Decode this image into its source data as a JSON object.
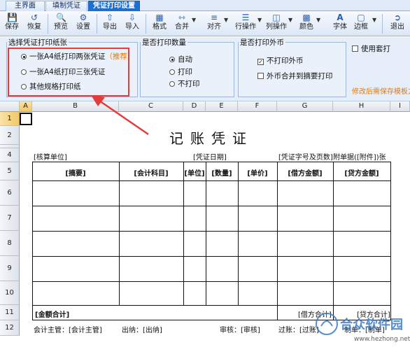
{
  "tabs": [
    {
      "label": "主界面",
      "active": false
    },
    {
      "label": "填制凭证",
      "active": false
    },
    {
      "label": "凭证打印设置",
      "active": true
    }
  ],
  "toolbar": {
    "save": "保存",
    "restore": "恢复",
    "preview": "预览",
    "settings": "设置",
    "export": "导出",
    "import": "导入",
    "format": "格式",
    "merge": "合并",
    "align": "对齐",
    "row_ops": "行操作",
    "col_ops": "列操作",
    "color": "颜色",
    "font": "字体",
    "border": "边框",
    "exit": "退出"
  },
  "paper": {
    "legend": "选择凭证打印纸张",
    "options": [
      "一张A4纸打印两张凭证",
      "一张A4纸打印三张凭证",
      "其他规格打印纸"
    ],
    "recommend": "（推荐）",
    "selected_index": 0
  },
  "copies": {
    "legend": "是否打印数量",
    "options": [
      "自动",
      "打印",
      "不打印"
    ],
    "selected_index": 0
  },
  "foreign": {
    "legend": "是否打印外币",
    "options": [
      "不打印外币",
      "外币合并到摘要打印"
    ],
    "checked": [
      true,
      false
    ]
  },
  "use_template": {
    "label": "使用套打",
    "checked": false
  },
  "hint": "修改后需保存模板方",
  "columns": [
    "A",
    "B",
    "C",
    "D",
    "E",
    "F",
    "G",
    "H",
    "I"
  ],
  "rows": [
    "1",
    "2",
    "3",
    "4",
    "5",
    "6",
    "7",
    "8",
    "9",
    "10",
    "11",
    "12"
  ],
  "voucher": {
    "title": "记账凭证",
    "unit": "[核算单位]",
    "date": "[凭证日期]",
    "number": "[凭证字号及页数]",
    "attach": "附单据([附件])张",
    "headers": [
      "[摘要]",
      "[会计科目]",
      "[单位]",
      "[数量]",
      "[单价]",
      "[借方金额]",
      "[贷方金额]"
    ],
    "total_label": "[金额合计]",
    "debit_total": "[借方合计]",
    "credit_total": "[贷方合计]",
    "footer": {
      "supervisor": "会计主管：[会计主管]",
      "cashier": "出纳：[出纳]",
      "reviewer": "审核：[审核]",
      "poster": "过账：[过账]",
      "maker": "制单：[制单]"
    }
  },
  "watermark": {
    "text": "合众软件园",
    "url": "www.hezhong.net"
  }
}
